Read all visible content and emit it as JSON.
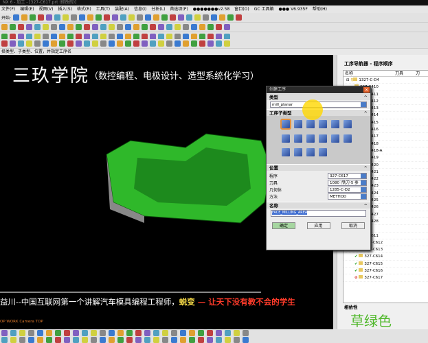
{
  "titlebar": {
    "title": "NX 6 - 加工 - [327-C617.prt (修改的)]"
  },
  "menu": [
    "文件(F)",
    "编辑(E)",
    "视图(V)",
    "插入(S)",
    "格式(R)",
    "工具(T)",
    "装配(A)",
    "信息(I)",
    "分析(L)",
    "首选项(P)",
    "●●●●●●●v2.58",
    "窗口(O)",
    "GC 工具箱",
    "●●● V6.935F",
    "帮助(H)"
  ],
  "toolbar": {
    "start_label": "开始·"
  },
  "hint": "择类型、子类型、位置，并指定工序名",
  "viewport": {
    "brand": "三玖学院",
    "brand_sub": "（数控编程、电极设计、造型系统化学习）",
    "caption_a": "益川--中国互联网第一个讲解汽车模具编程工程师，",
    "caption_b": "蜕变",
    "caption_c": " — 让天下没有教不会的学生",
    "view_info": "OP WORK Camera TOP",
    "part_color": "#2fb82a"
  },
  "navigator": {
    "title": "工序导航器 - 程序顺序",
    "columns": [
      "名称",
      "刀具",
      "刀"
    ],
    "rows": [
      {
        "name": "1327-C-D4",
        "status": "folder"
      },
      {
        "name": "327-C410"
      },
      {
        "name": "327-C411"
      },
      {
        "name": "327-C412"
      },
      {
        "name": "327-C413"
      },
      {
        "name": "327-C414"
      },
      {
        "name": "327-C415"
      },
      {
        "name": "327-C416"
      },
      {
        "name": "327-C417"
      },
      {
        "name": "327-C418"
      },
      {
        "name": "327-C418-A"
      },
      {
        "name": "327-C419"
      },
      {
        "name": "327-C420"
      },
      {
        "name": "327-C421"
      },
      {
        "name": "327-C422"
      },
      {
        "name": "327-C423"
      },
      {
        "name": "327-C424"
      },
      {
        "name": "327-C425"
      },
      {
        "name": "327-C426"
      },
      {
        "name": "327-C427"
      },
      {
        "name": "327-C428"
      },
      {
        "name": "-C-D5",
        "status": "folder"
      },
      {
        "name": "327-C611"
      },
      {
        "name": "327-C612",
        "status": "done"
      },
      {
        "name": "327-C613",
        "status": "done"
      },
      {
        "name": "327-C614",
        "status": "done"
      },
      {
        "name": "327-C615",
        "status": "done"
      },
      {
        "name": "327-C616",
        "status": "done"
      },
      {
        "name": "327-C617",
        "status": "blocked"
      }
    ],
    "dependency_label": "相依性"
  },
  "color_label": "草绿色",
  "dialog": {
    "title": "创建工序",
    "type_section": "类型",
    "type_value": "mill_planar",
    "subtype_section": "工序子类型",
    "location_section": "位置",
    "fields": [
      {
        "label": "程序",
        "value": "327-C617"
      },
      {
        "label": "刀具",
        "value": "1080 (铣刀-5 参"
      },
      {
        "label": "几何体",
        "value": "1285-C-D2"
      },
      {
        "label": "方法",
        "value": "METHOD"
      }
    ],
    "name_section": "名称",
    "name_value": "FACE_MILLING_AREA",
    "ok": "确定",
    "apply": "应用",
    "cancel": "取消"
  }
}
